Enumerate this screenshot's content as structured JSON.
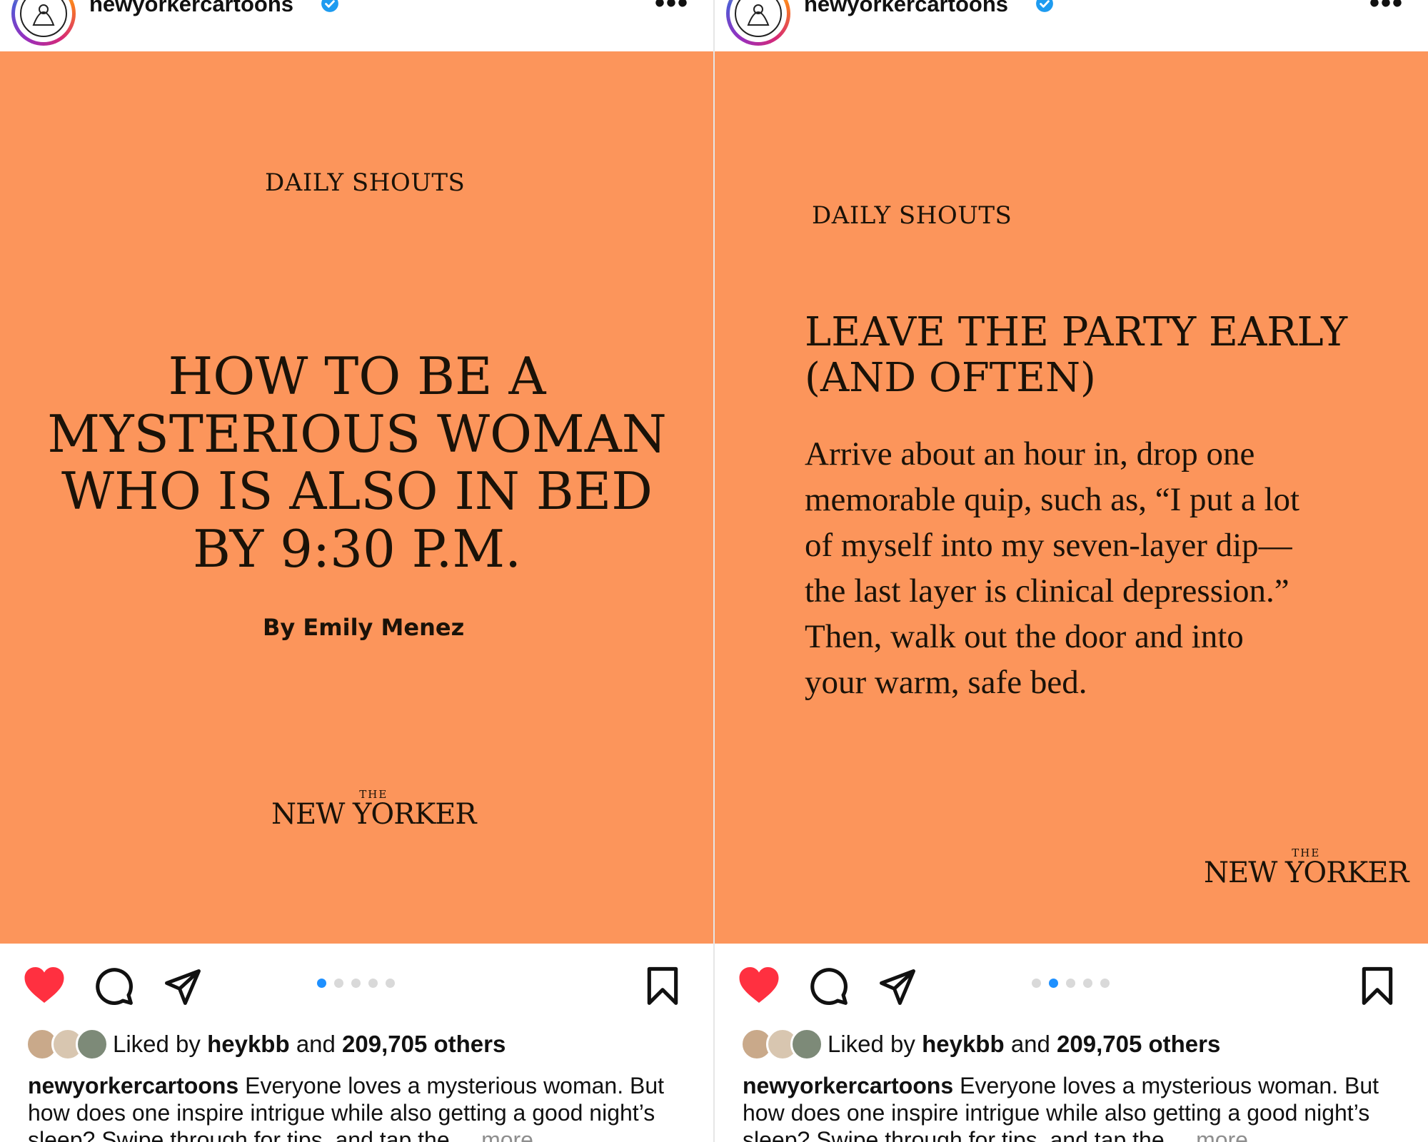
{
  "posts": [
    {
      "username": "newyorkercartoons",
      "more_label": "•••",
      "slide": {
        "kicker": "DAILY SHOUTS",
        "headline_lines": [
          "HOW TO BE A",
          "MYSTERIOUS WOMAN",
          "WHO IS ALSO IN BED",
          "BY 9:30 P.M."
        ],
        "byline": "By Emily Menez",
        "logo_the": "THE",
        "logo_name": "NEW YORKER",
        "background": "#fc955b"
      },
      "carousel": {
        "count": 5,
        "active": 0
      },
      "likes": {
        "prefix": "Liked by",
        "user": "heykbb",
        "joiner": "and",
        "count": "209,705 others"
      },
      "caption": {
        "user": "newyorkercartoons",
        "text": "Everyone loves a mysterious woman. But how does one inspire intrigue while also getting a good night’s sleep? Swipe through for tips, and tap the",
        "more": "... more"
      }
    },
    {
      "username": "newyorkercartoons",
      "more_label": "•••",
      "slide": {
        "kicker": "DAILY SHOUTS",
        "headline_lines": [
          "LEAVE THE PARTY EARLY",
          "(AND OFTEN)"
        ],
        "body_lines": [
          "Arrive about an hour in, drop one",
          "memorable quip, such as, “I put a lot",
          "of myself into my seven-layer dip—",
          "the last layer is clinical depression.”",
          "Then, walk out the door and into",
          "your warm, safe bed."
        ],
        "logo_the": "THE",
        "logo_name": "NEW YORKER",
        "background": "#fc955b"
      },
      "carousel": {
        "count": 5,
        "active": 1
      },
      "likes": {
        "prefix": "Liked by",
        "user": "heykbb",
        "joiner": "and",
        "count": "209,705 others"
      },
      "caption": {
        "user": "newyorkercartoons",
        "text": "Everyone loves a mysterious woman. But how does one inspire intrigue while also getting a good night’s sleep? Swipe through for tips, and tap the",
        "more": "... more"
      }
    }
  ],
  "colors": {
    "like_red": "#ff3040",
    "verified_blue": "#1d9bf0",
    "dot_active": "#1e90ff",
    "dot_inactive": "#d9d9d9"
  },
  "icons": [
    "heart-icon",
    "comment-icon",
    "share-icon",
    "bookmark-icon",
    "verified-icon",
    "more-icon"
  ]
}
